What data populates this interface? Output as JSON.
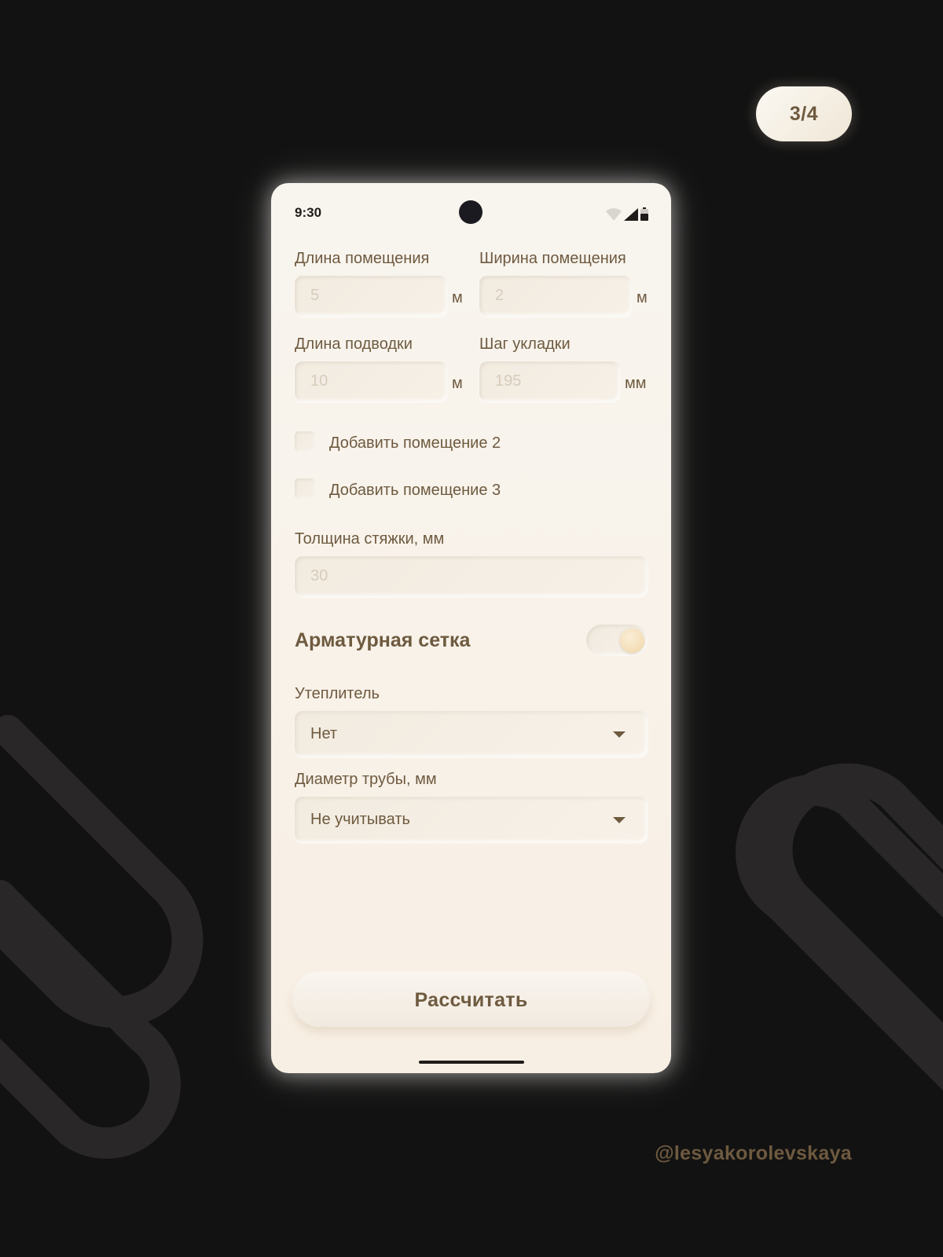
{
  "page_indicator": "3/4",
  "watermark": "@lesyakorolevskaya",
  "status_bar": {
    "time": "9:30",
    "icons": [
      "wifi-icon",
      "signal-icon",
      "battery-icon"
    ]
  },
  "form": {
    "room_length": {
      "label": "Длина помещения",
      "value": "5",
      "unit": "м"
    },
    "room_width": {
      "label": "Ширина помещения",
      "value": "2",
      "unit": "м"
    },
    "feed_length": {
      "label": "Длина подводки",
      "value": "10",
      "unit": "м"
    },
    "laying_step": {
      "label": "Шаг укладки",
      "value": "195",
      "unit": "мм"
    },
    "add_room_2": {
      "label": "Добавить помещение 2",
      "checked": false
    },
    "add_room_3": {
      "label": "Добавить помещение 3",
      "checked": false
    },
    "screed_thickness": {
      "label": "Толщина стяжки, мм",
      "value": "30"
    },
    "reinforcement_mesh": {
      "label": "Арматурная сетка",
      "enabled": true
    },
    "insulation": {
      "label": "Утеплитель",
      "selected": "Нет"
    },
    "pipe_diameter": {
      "label": "Диаметр трубы, мм",
      "selected": "Не учитывать"
    },
    "calculate_button": "Рассчитать"
  },
  "colors": {
    "background": "#121212",
    "screen": "#f8f3ec",
    "text_brown": "#6e5a3f",
    "placeholder": "#d6ccbc",
    "toggle_knob": "#f0d6a9",
    "decor_stroke": "#2a2828"
  }
}
